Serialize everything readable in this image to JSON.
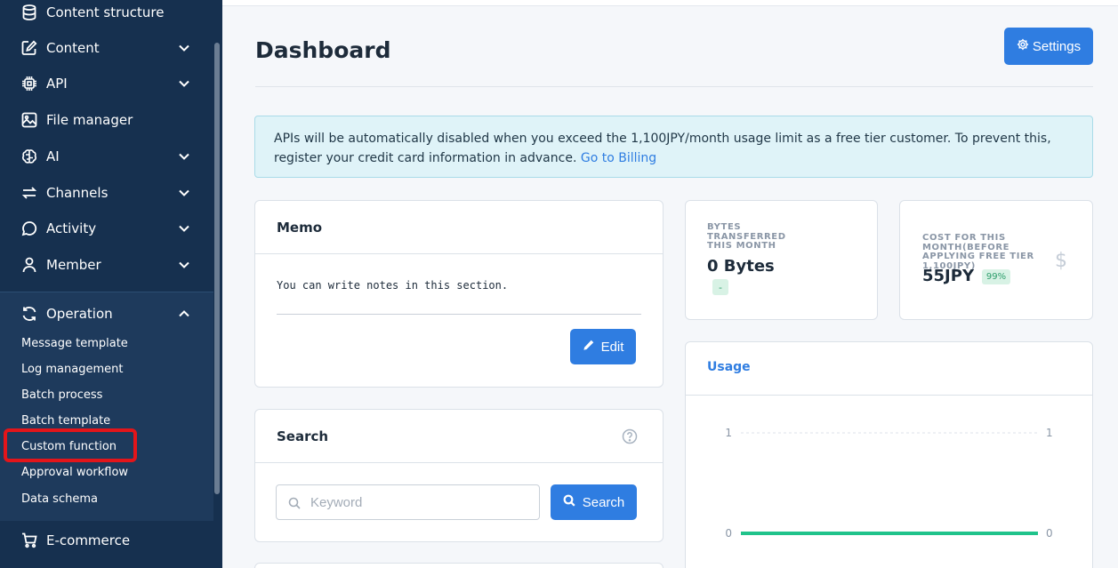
{
  "sidebar": {
    "items": [
      {
        "label": "Content structure",
        "icon": "database-icon",
        "has_chevron": false
      },
      {
        "label": "Content",
        "icon": "edit-icon",
        "has_chevron": true
      },
      {
        "label": "API",
        "icon": "chip-icon",
        "has_chevron": true
      },
      {
        "label": "File manager",
        "icon": "image-icon",
        "has_chevron": true
      },
      {
        "label": "AI",
        "icon": "brain-icon",
        "has_chevron": true
      },
      {
        "label": "Channels",
        "icon": "sync-icon",
        "has_chevron": true
      },
      {
        "label": "Activity",
        "icon": "chat-icon",
        "has_chevron": true
      },
      {
        "label": "Member",
        "icon": "user-icon",
        "has_chevron": true
      }
    ],
    "operation": {
      "label": "Operation",
      "icon": "refresh-icon",
      "expanded": true,
      "sub_items": [
        "Message template",
        "Log management",
        "Batch process",
        "Batch template",
        "Custom function",
        "Approval workflow",
        "Data schema"
      ]
    },
    "ecommerce": {
      "label": "E-commerce",
      "icon": "cart-icon"
    }
  },
  "header": {
    "title": "Dashboard",
    "settings_label": "Settings"
  },
  "alert": {
    "text": "APIs will be automatically disabled when you exceed the 1,100JPY/month usage limit as a free tier customer. To prevent this, register your credit card information in advance. ",
    "link": "Go to Billing"
  },
  "memo": {
    "title": "Memo",
    "text": "You can write notes in this section.",
    "edit_label": "Edit"
  },
  "search": {
    "title": "Search",
    "placeholder": "Keyword",
    "value": "",
    "button_label": "Search"
  },
  "stats": {
    "bytes": {
      "label": "BYTES TRANSFERRED THIS MONTH",
      "value": "0 Bytes",
      "badge": "-"
    },
    "cost": {
      "label": "COST FOR THIS MONTH(BEFORE APPLYING FREE TIER 1,100JPY)",
      "value": "55JPY",
      "badge": "99%",
      "icon": "dollar-icon"
    }
  },
  "usage": {
    "title": "Usage"
  },
  "chart_data": {
    "type": "line",
    "title": "",
    "x": [],
    "series": [
      {
        "values": [
          0,
          0
        ],
        "color": "#20c38b"
      }
    ],
    "ylim": [
      0,
      1
    ],
    "y_ticks_left": [
      "1",
      "0"
    ],
    "y_ticks_right": [
      "1",
      "0"
    ],
    "grid": true
  },
  "colors": {
    "sidebar_bg": "#16304f",
    "accent": "#2f7de1",
    "highlight": "#e3151a",
    "success": "#20c38b"
  }
}
